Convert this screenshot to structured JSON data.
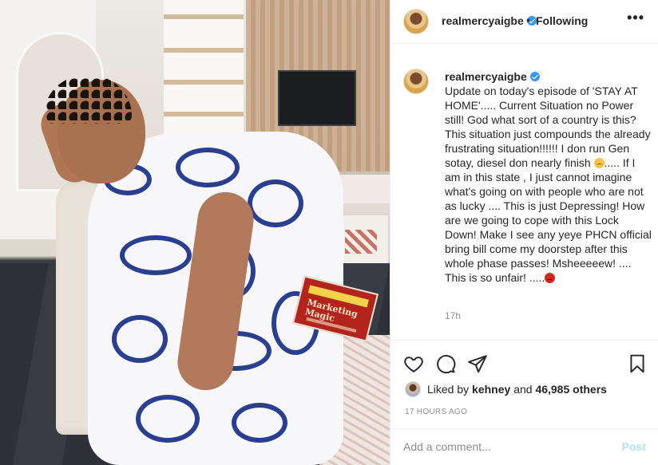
{
  "header": {
    "username": "realmercyaigbe",
    "separator": "•",
    "follow_status": "Following",
    "more_icon": "more-horizontal-icon",
    "more_label": "•••"
  },
  "post_image": {
    "book_title": "Marketing Magic"
  },
  "caption": {
    "username": "realmercyaigbe",
    "text_part1": "Update on today's episode of 'STAY AT HOME'..... Current Situation no Power still! God what sort of a country is this? This situation just compounds the already frustrating situation!!!!!! I don run Gen sotay, diesel don nearly finish ",
    "emoji1": "sad-face-emoji",
    "text_part2": "..... If I am in this state , I just cannot imagine what's going on with people who are not as lucky .... This is just Depressing! How are we going to cope with this Lock Down! Make I see any yeye PHCN official bring bill come my doorstep after this whole phase passes! Msheeeeew! .... This is so unfair! .....",
    "emoji2": "angry-face-emoji",
    "time_ago": "17h"
  },
  "actions": {
    "like_icon": "heart-icon",
    "comment_icon": "comment-icon",
    "share_icon": "share-icon",
    "save_icon": "bookmark-icon"
  },
  "likes": {
    "prefix": "Liked by ",
    "user": "kehney",
    "middle": " and ",
    "count": "46,985 others"
  },
  "timestamp": "17 HOURS AGO",
  "comment": {
    "placeholder": "Add a comment...",
    "post_label": "Post"
  },
  "colors": {
    "verified": "#3897f0",
    "post_disabled": "#b2dffc",
    "muted_text": "#8e8e8e",
    "border": "#efefef"
  }
}
